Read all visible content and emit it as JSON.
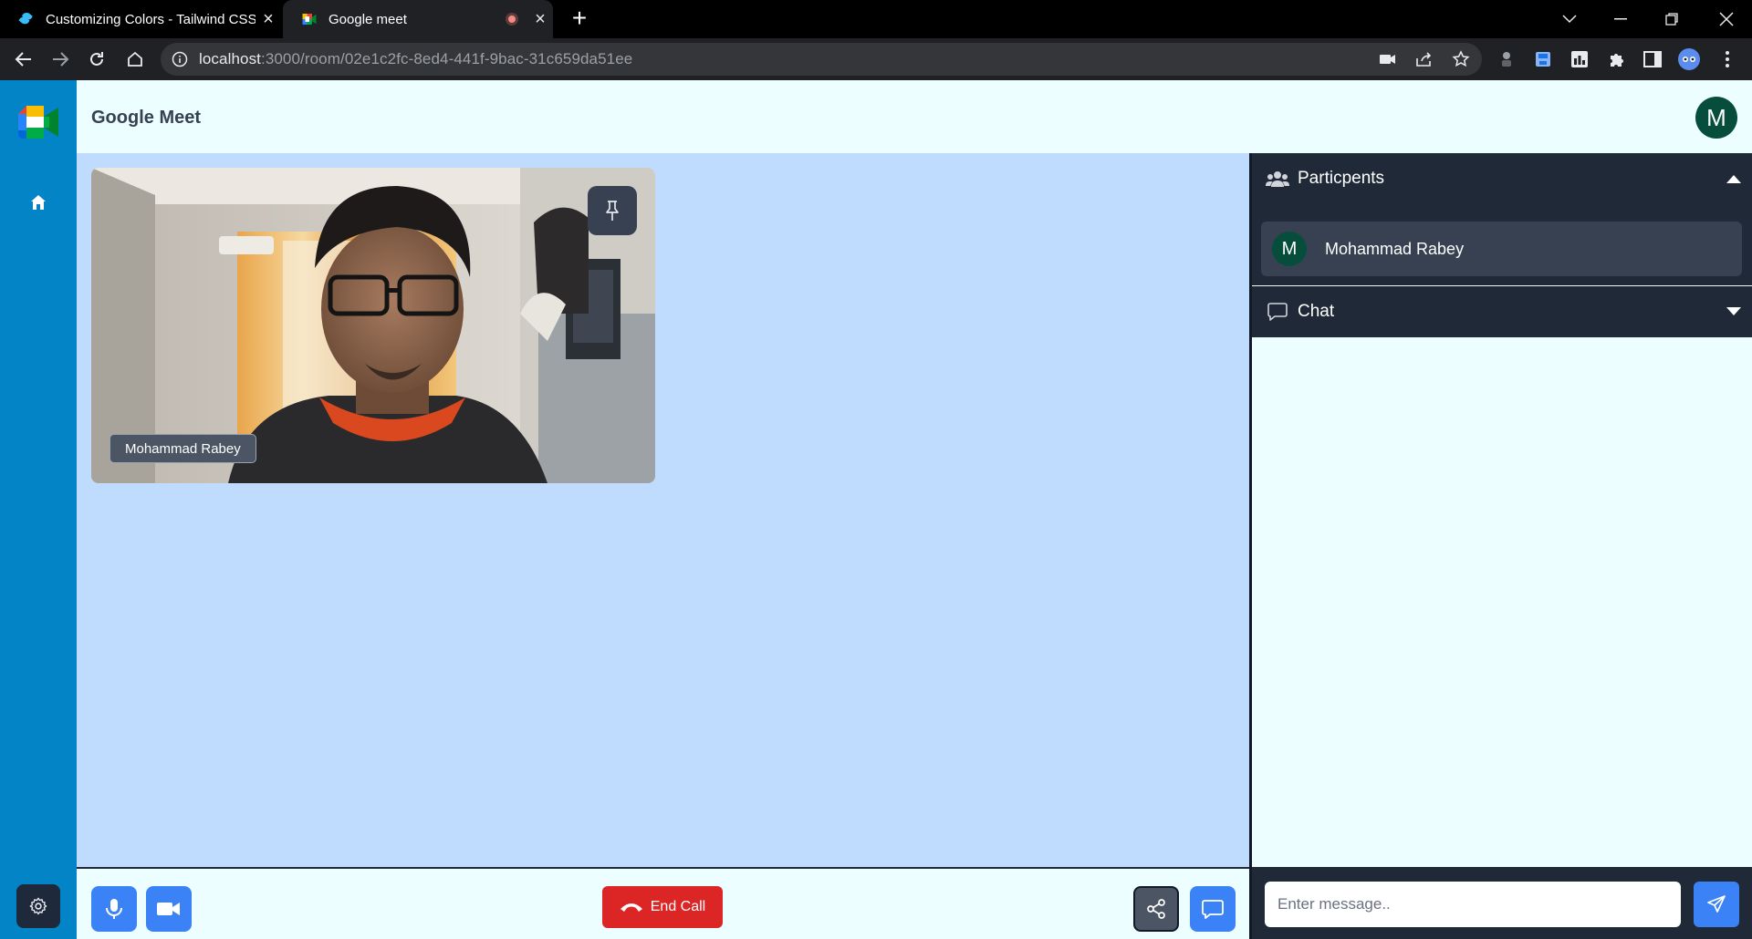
{
  "browser": {
    "tabs": [
      {
        "title": "Customizing Colors - Tailwind CSS",
        "favicon": "tailwind-icon"
      },
      {
        "title": "Google meet",
        "favicon": "google-meet-icon",
        "recording": true
      }
    ],
    "url_host": "localhost",
    "url_path": ":3000/room/02e1c2fc-8ed4-441f-9bac-31c659da51ee"
  },
  "header": {
    "title": "Google Meet",
    "avatar_initial": "M"
  },
  "video": {
    "participant_name": "Mohammad Rabey"
  },
  "panel": {
    "participants_label": "Particpents",
    "participants": [
      {
        "initial": "M",
        "name": "Mohammad Rabey"
      }
    ],
    "chat_label": "Chat"
  },
  "controls": {
    "end_call_label": "End Call"
  },
  "chat": {
    "input_placeholder": "Enter message.."
  },
  "colors": {
    "sidebar": "#0284c7",
    "stage": "#bfdbfe",
    "background": "#ecfeff",
    "panel_dark": "#1f2937",
    "end_call": "#dc2626",
    "accent_blue": "#3b82f6",
    "avatar": "#064e3b"
  }
}
